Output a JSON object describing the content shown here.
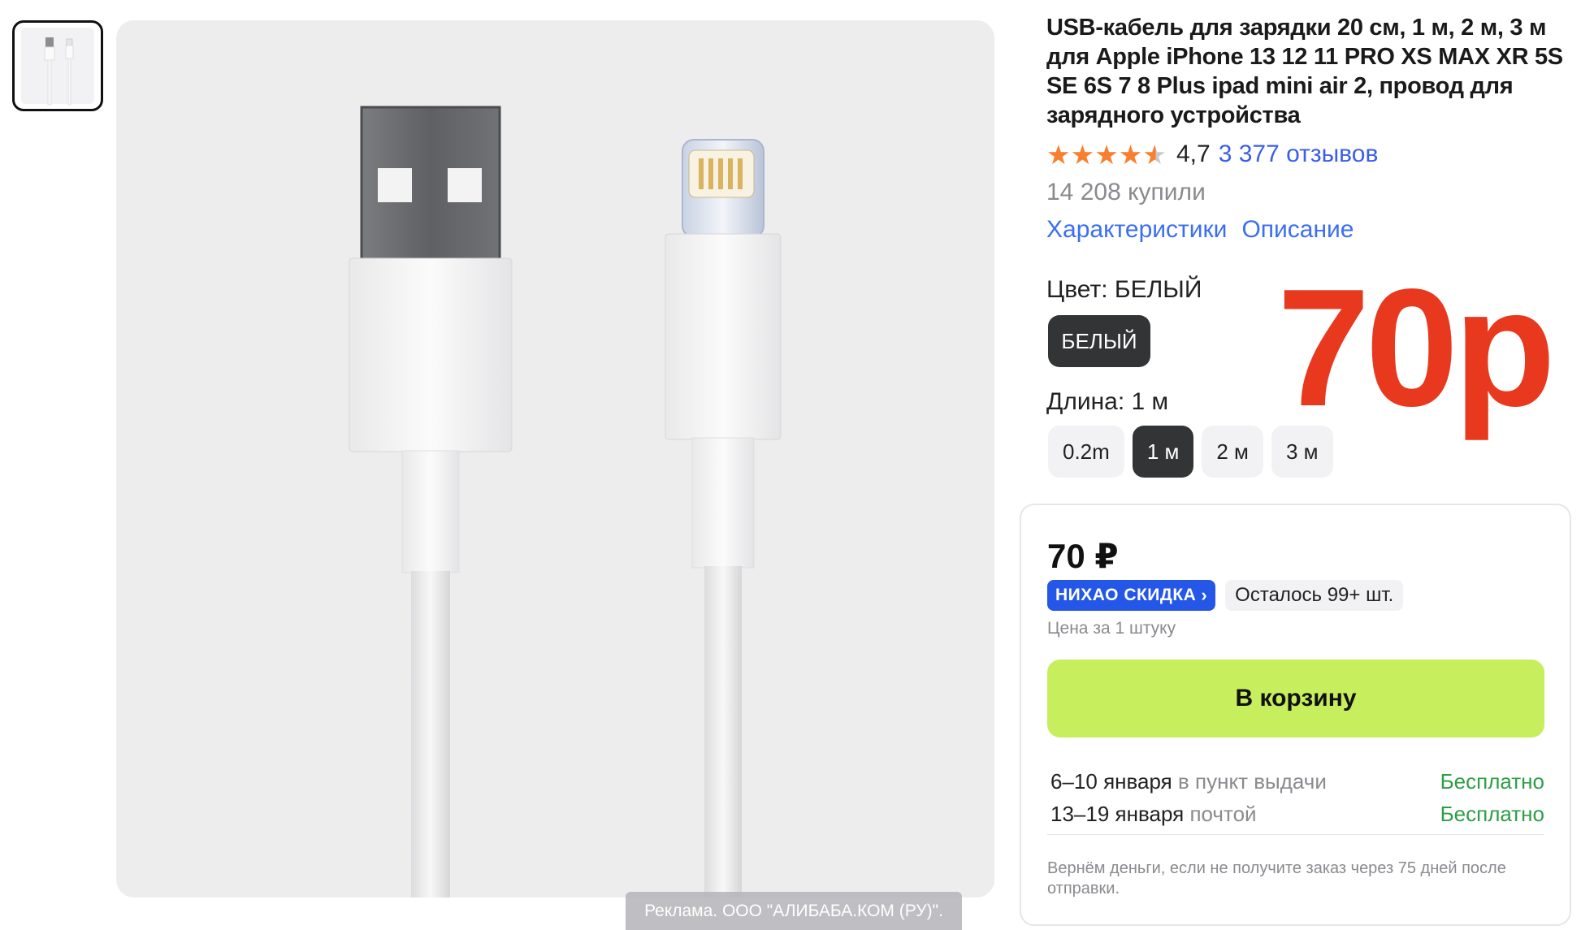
{
  "gallery": {
    "thumbnail_alt": "cable-thumbnail",
    "ad_notice": "Реклама. ООО \"АЛИБАБА.КОМ (РУ)\"."
  },
  "product": {
    "title": "USB-кабель для зарядки 20 см, 1 м, 2 м, 3 м для Apple iPhone 13 12 11 PRO XS MAX XR 5S SE 6S 7 8 Plus ipad mini air 2, провод для зарядного устройства",
    "rating_value": "4,7",
    "rating_fraction": 0.94,
    "reviews_link": "3 377 отзывов",
    "bought_count": "14 208 купили",
    "tabs": [
      "Характеристики",
      "Описание"
    ],
    "color_label": "Цвет: БЕЛЫЙ",
    "color_selected": "БЕЛЫЙ",
    "length_label": "Длина: 1 м",
    "length_options": [
      "0.2m",
      "1 м",
      "2 м",
      "3 м"
    ],
    "length_selected_index": 1,
    "overlay_price": "70р"
  },
  "buy_box": {
    "price": "70 ₽",
    "promo_badge": "НИХАО СКИДКА",
    "stock": "Осталось 99+ шт.",
    "unit_note": "Цена за 1 штуку",
    "cart_button": "В корзину",
    "deliveries": [
      {
        "dates": "6–10 января",
        "method": "в пункт выдачи",
        "cost": "Бесплатно"
      },
      {
        "dates": "13–19 января",
        "method": "почтой",
        "cost": "Бесплатно"
      }
    ],
    "refund_note": "Вернём деньги, если не получите заказ через 75 дней после отправки."
  },
  "colors": {
    "link": "#3b6ff0",
    "star": "#f97e2e",
    "overlay_price": "#e8391f",
    "cart_button": "#c7ee5c",
    "free_delivery": "#2e9e46",
    "selected_chip": "#333436",
    "promo_badge": "#2457e8"
  }
}
